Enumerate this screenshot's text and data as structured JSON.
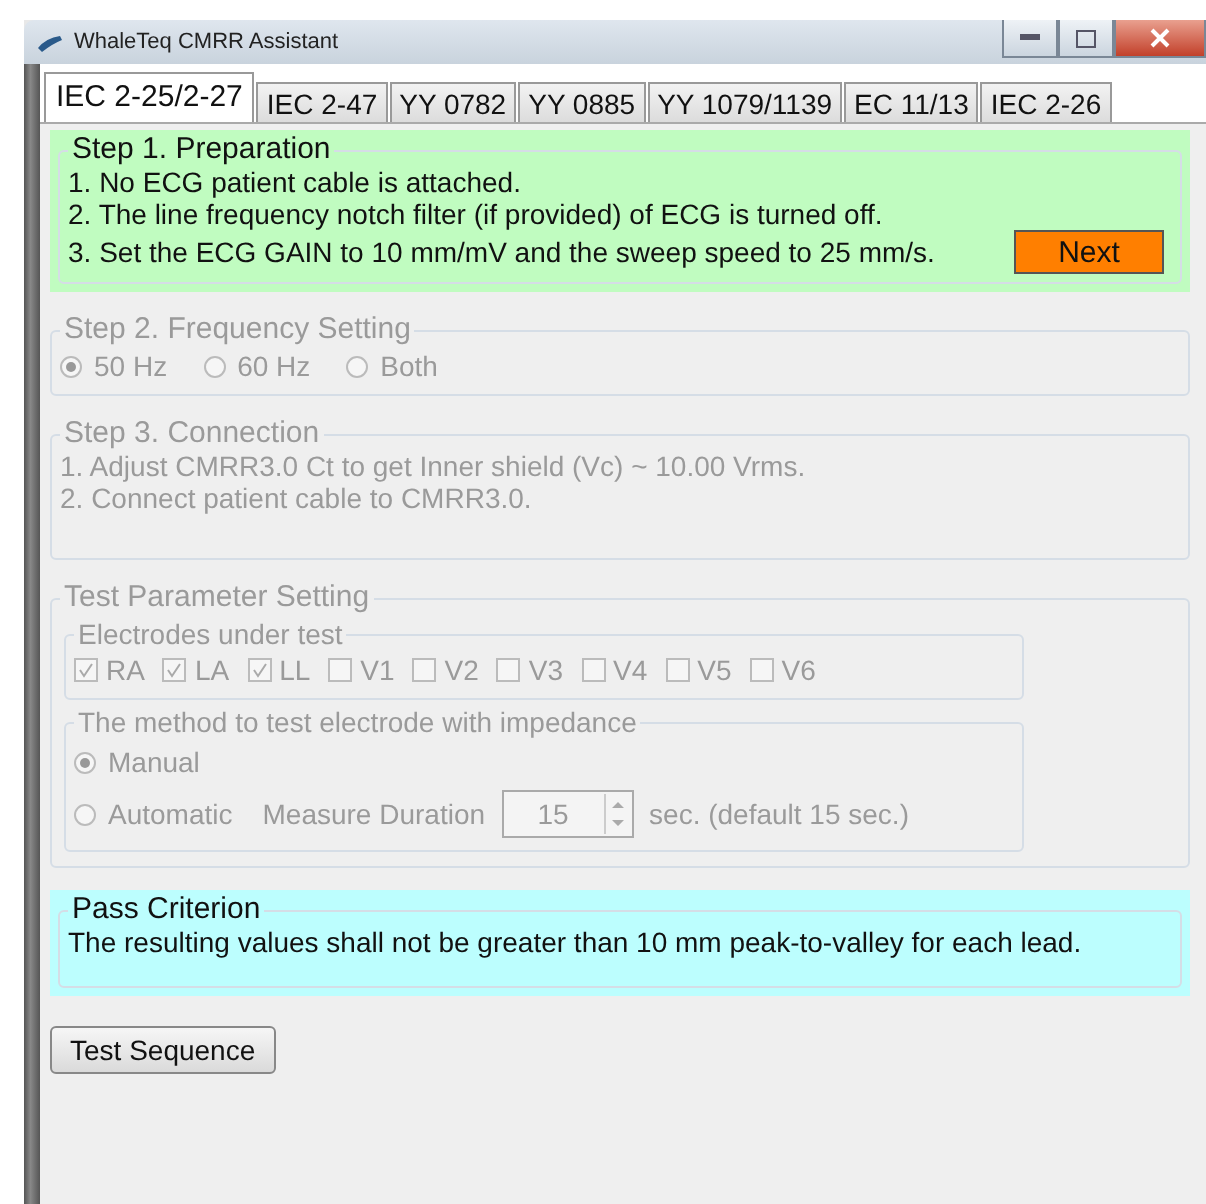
{
  "window": {
    "title": "WhaleTeq CMRR Assistant"
  },
  "tabs": [
    {
      "label": "IEC 2-25/2-27",
      "selected": true
    },
    {
      "label": "IEC 2-47",
      "selected": false
    },
    {
      "label": "YY 0782",
      "selected": false
    },
    {
      "label": "YY 0885",
      "selected": false
    },
    {
      "label": "YY 1079/1139",
      "selected": false
    },
    {
      "label": "EC 11/13",
      "selected": false
    },
    {
      "label": "IEC 2-26",
      "selected": false
    }
  ],
  "step1": {
    "title": "Step 1. Preparation",
    "disabled": false,
    "lines": [
      "1. No ECG patient cable is attached.",
      "2. The line frequency notch filter (if provided) of ECG is turned off.",
      "3. Set the ECG GAIN to 10 mm/mV and the sweep speed to 25 mm/s."
    ],
    "next_button": "Next"
  },
  "step2": {
    "title": "Step 2. Frequency Setting",
    "disabled": true,
    "options": [
      {
        "label": "50 Hz",
        "selected": true
      },
      {
        "label": "60 Hz",
        "selected": false
      },
      {
        "label": "Both",
        "selected": false
      }
    ]
  },
  "step3": {
    "title": "Step 3. Connection",
    "disabled": true,
    "lines": [
      "1. Adjust CMRR3.0 Ct to get Inner shield (Vc) ~ 10.00 Vrms.",
      "2. Connect patient cable to CMRR3.0."
    ]
  },
  "test_parameters": {
    "title": "Test Parameter Setting",
    "disabled": true,
    "electrodes": {
      "title": "Electrodes under test",
      "items": [
        {
          "label": "RA",
          "checked": true
        },
        {
          "label": "LA",
          "checked": true
        },
        {
          "label": "LL",
          "checked": true
        },
        {
          "label": "V1",
          "checked": false
        },
        {
          "label": "V2",
          "checked": false
        },
        {
          "label": "V3",
          "checked": false
        },
        {
          "label": "V4",
          "checked": false
        },
        {
          "label": "V5",
          "checked": false
        },
        {
          "label": "V6",
          "checked": false
        }
      ]
    },
    "method": {
      "title": "The method to test electrode with impedance",
      "manual": {
        "label": "Manual",
        "selected": true
      },
      "automatic": {
        "label": "Automatic",
        "selected": false
      },
      "duration_label": "Measure Duration",
      "duration_value": "15",
      "duration_hint": "sec. (default 15 sec.)"
    }
  },
  "pass_criterion": {
    "title": "Pass Criterion",
    "text": "The resulting values shall not be greater than 10 mm peak-to-valley for each lead."
  },
  "test_sequence_button": "Test Sequence"
}
